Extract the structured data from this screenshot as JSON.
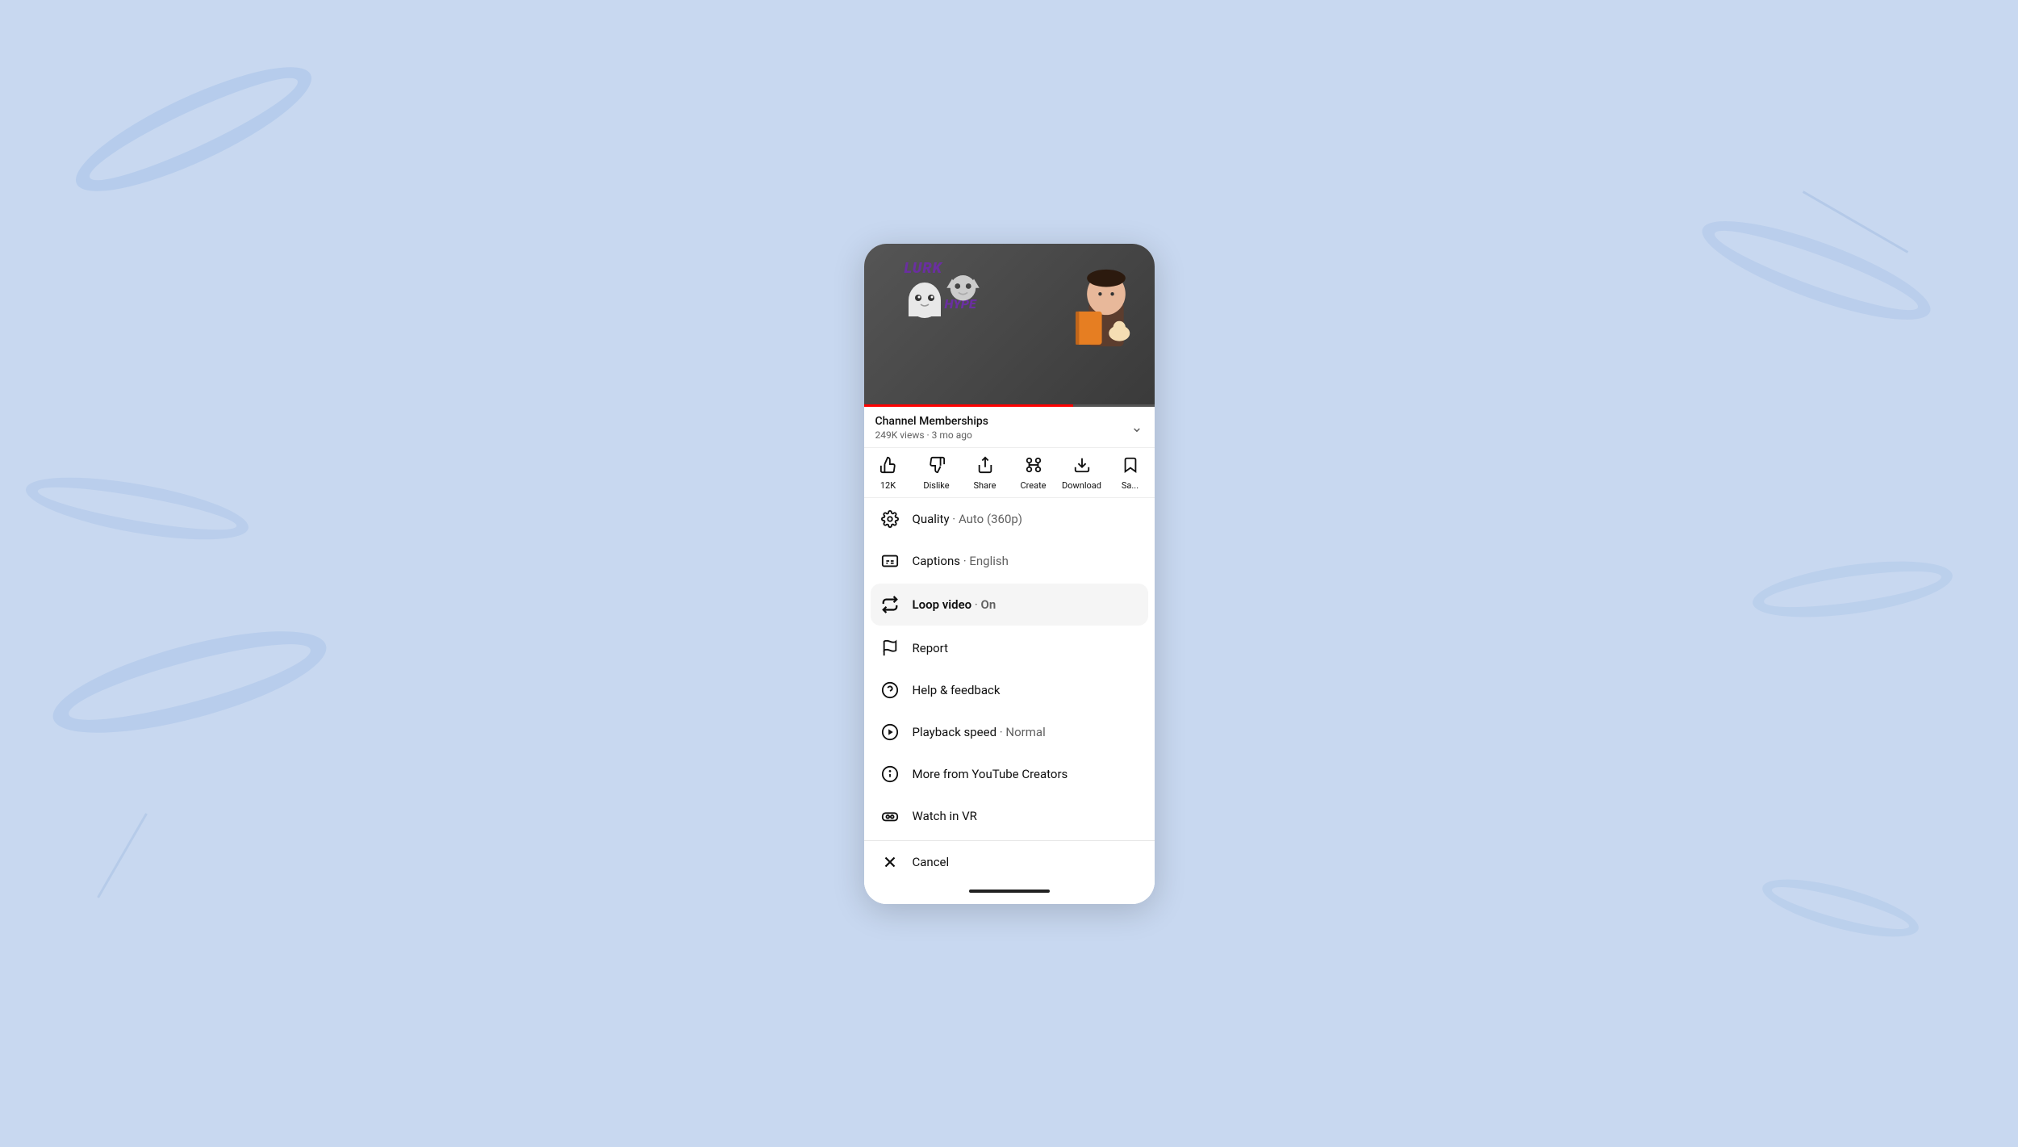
{
  "background": {
    "color": "#c8d8f0"
  },
  "video": {
    "channel_title": "Channel Memberships",
    "views": "249K views",
    "time_ago": "3 mo ago",
    "meta": "249K views · 3 mo ago",
    "progress_percent": 72
  },
  "action_bar": {
    "like": {
      "label": "12K",
      "icon": "👍"
    },
    "dislike": {
      "label": "Dislike",
      "icon": "👎"
    },
    "share": {
      "label": "Share",
      "icon": "↗"
    },
    "create": {
      "label": "Create",
      "icon": "✂"
    },
    "download": {
      "label": "Download",
      "icon": "⬇"
    },
    "save": {
      "label": "Sa...",
      "icon": "🔖"
    }
  },
  "menu": {
    "items": [
      {
        "id": "quality",
        "label": "Quality",
        "value": "Auto (360p)",
        "icon": "gear"
      },
      {
        "id": "captions",
        "label": "Captions",
        "value": "English",
        "icon": "cc"
      },
      {
        "id": "loop",
        "label": "Loop video",
        "value": "On",
        "icon": "loop",
        "highlighted": true
      },
      {
        "id": "report",
        "label": "Report",
        "value": "",
        "icon": "flag"
      },
      {
        "id": "help",
        "label": "Help & feedback",
        "value": "",
        "icon": "help"
      },
      {
        "id": "playback",
        "label": "Playback speed",
        "value": "Normal",
        "icon": "speed"
      },
      {
        "id": "more",
        "label": "More from YouTube Creators",
        "value": "",
        "icon": "info"
      },
      {
        "id": "vr",
        "label": "Watch in VR",
        "value": "",
        "icon": "vr"
      }
    ],
    "cancel_label": "Cancel"
  }
}
